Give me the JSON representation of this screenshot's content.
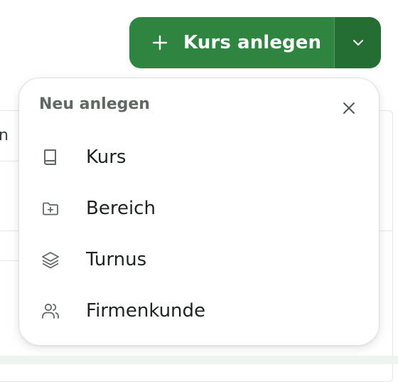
{
  "colors": {
    "button_primary": "#2e8540",
    "button_toggle": "#246e33",
    "menu_title": "#5f6862",
    "icon": "#5f6862"
  },
  "background": {
    "partial_text": "n"
  },
  "split_button": {
    "label": "Kurs anlegen",
    "icon": "plus-icon",
    "toggle_icon": "chevron-down-icon"
  },
  "menu": {
    "title": "Neu anlegen",
    "close_icon": "close-icon",
    "items": [
      {
        "label": "Kurs",
        "icon": "book-icon"
      },
      {
        "label": "Bereich",
        "icon": "folder-plus-icon"
      },
      {
        "label": "Turnus",
        "icon": "layers-icon"
      },
      {
        "label": "Firmenkunde",
        "icon": "users-icon"
      }
    ]
  }
}
